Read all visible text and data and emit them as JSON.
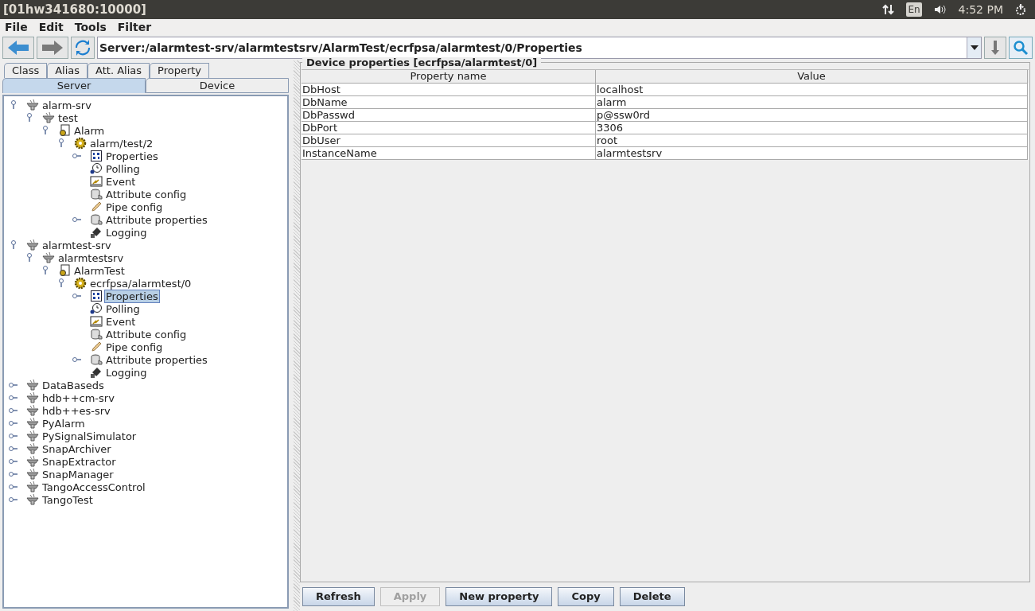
{
  "window": {
    "title": "[01hw341680:10000]"
  },
  "system_tray": {
    "keyboard_layout": "En",
    "time": "4:52 PM"
  },
  "menu": [
    "File",
    "Edit",
    "Tools",
    "Filter"
  ],
  "toolbar": {
    "path": "Server:/alarmtest-srv/alarmtestsrv/AlarmTest/ecrfpsa/alarmtest/0/Properties"
  },
  "tabs_top": [
    {
      "label": "Class",
      "selected": false
    },
    {
      "label": "Alias",
      "selected": false
    },
    {
      "label": "Att. Alias",
      "selected": false
    },
    {
      "label": "Property",
      "selected": false
    }
  ],
  "tabs_bottom": [
    {
      "label": "Server",
      "selected": true
    },
    {
      "label": "Device",
      "selected": false
    }
  ],
  "tree": [
    {
      "label": "alarm-srv",
      "kind": "server",
      "expandable": true,
      "expanded": true,
      "selected": false,
      "children": [
        {
          "label": "test",
          "kind": "server",
          "expandable": true,
          "expanded": true,
          "selected": false,
          "children": [
            {
              "label": "Alarm",
              "kind": "class",
              "expandable": true,
              "expanded": true,
              "selected": false,
              "children": [
                {
                  "label": "alarm/test/2",
                  "kind": "device",
                  "expandable": true,
                  "expanded": true,
                  "selected": false,
                  "children": [
                    {
                      "label": "Properties",
                      "kind": "properties",
                      "expandable": true,
                      "expanded": false,
                      "selected": false
                    },
                    {
                      "label": "Polling",
                      "kind": "polling",
                      "expandable": false,
                      "selected": false
                    },
                    {
                      "label": "Event",
                      "kind": "event",
                      "expandable": false,
                      "selected": false
                    },
                    {
                      "label": "Attribute config",
                      "kind": "attribute",
                      "expandable": false,
                      "selected": false
                    },
                    {
                      "label": "Pipe config",
                      "kind": "pipe",
                      "expandable": false,
                      "selected": false
                    },
                    {
                      "label": "Attribute properties",
                      "kind": "attribute",
                      "expandable": true,
                      "expanded": false,
                      "selected": false
                    },
                    {
                      "label": "Logging",
                      "kind": "logging",
                      "expandable": false,
                      "selected": false
                    }
                  ]
                }
              ]
            }
          ]
        }
      ]
    },
    {
      "label": "alarmtest-srv",
      "kind": "server",
      "expandable": true,
      "expanded": true,
      "selected": false,
      "children": [
        {
          "label": "alarmtestsrv",
          "kind": "server",
          "expandable": true,
          "expanded": true,
          "selected": false,
          "children": [
            {
              "label": "AlarmTest",
              "kind": "class",
              "expandable": true,
              "expanded": true,
              "selected": false,
              "children": [
                {
                  "label": "ecrfpsa/alarmtest/0",
                  "kind": "device",
                  "expandable": true,
                  "expanded": true,
                  "selected": false,
                  "children": [
                    {
                      "label": "Properties",
                      "kind": "properties",
                      "expandable": true,
                      "expanded": false,
                      "selected": true
                    },
                    {
                      "label": "Polling",
                      "kind": "polling",
                      "expandable": false,
                      "selected": false
                    },
                    {
                      "label": "Event",
                      "kind": "event",
                      "expandable": false,
                      "selected": false
                    },
                    {
                      "label": "Attribute config",
                      "kind": "attribute",
                      "expandable": false,
                      "selected": false
                    },
                    {
                      "label": "Pipe config",
                      "kind": "pipe",
                      "expandable": false,
                      "selected": false
                    },
                    {
                      "label": "Attribute properties",
                      "kind": "attribute",
                      "expandable": true,
                      "expanded": false,
                      "selected": false
                    },
                    {
                      "label": "Logging",
                      "kind": "logging",
                      "expandable": false,
                      "selected": false
                    }
                  ]
                }
              ]
            }
          ]
        }
      ]
    },
    {
      "label": "DataBaseds",
      "kind": "server",
      "expandable": true,
      "expanded": false,
      "selected": false
    },
    {
      "label": "hdb++cm-srv",
      "kind": "server",
      "expandable": true,
      "expanded": false,
      "selected": false
    },
    {
      "label": "hdb++es-srv",
      "kind": "server",
      "expandable": true,
      "expanded": false,
      "selected": false
    },
    {
      "label": "PyAlarm",
      "kind": "server",
      "expandable": true,
      "expanded": false,
      "selected": false
    },
    {
      "label": "PySignalSimulator",
      "kind": "server",
      "expandable": true,
      "expanded": false,
      "selected": false
    },
    {
      "label": "SnapArchiver",
      "kind": "server",
      "expandable": true,
      "expanded": false,
      "selected": false
    },
    {
      "label": "SnapExtractor",
      "kind": "server",
      "expandable": true,
      "expanded": false,
      "selected": false
    },
    {
      "label": "SnapManager",
      "kind": "server",
      "expandable": true,
      "expanded": false,
      "selected": false
    },
    {
      "label": "TangoAccessControl",
      "kind": "server",
      "expandable": true,
      "expanded": false,
      "selected": false
    },
    {
      "label": "TangoTest",
      "kind": "server",
      "expandable": true,
      "expanded": false,
      "selected": false
    }
  ],
  "properties_panel": {
    "title": "Device properties [ecrfpsa/alarmtest/0]",
    "columns": [
      "Property name",
      "Value"
    ],
    "rows": [
      [
        "DbHost",
        "localhost"
      ],
      [
        "DbName",
        "alarm"
      ],
      [
        "DbPasswd",
        "p@ssw0rd"
      ],
      [
        "DbPort",
        "3306"
      ],
      [
        "DbUser",
        "root"
      ],
      [
        "InstanceName",
        "alarmtestsrv"
      ]
    ],
    "buttons": [
      {
        "label": "Refresh",
        "disabled": false
      },
      {
        "label": "Apply",
        "disabled": true
      },
      {
        "label": "New property",
        "disabled": false
      },
      {
        "label": "Copy",
        "disabled": false
      },
      {
        "label": "Delete",
        "disabled": false
      }
    ]
  }
}
